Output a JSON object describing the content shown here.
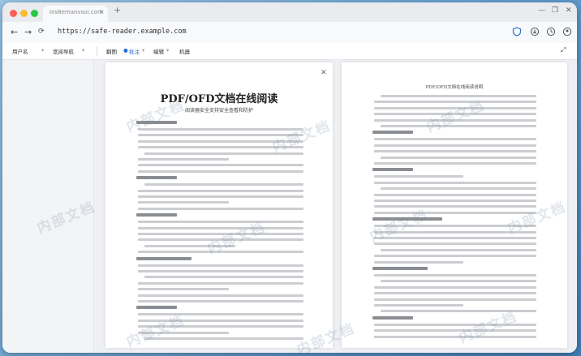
{
  "tab": {
    "title": "Ins8emanvsoi.com",
    "close": "×",
    "new": "+"
  },
  "nav": {
    "url": "https://safe-reader.example.com",
    "back": "←",
    "forward": "→",
    "reload": "C",
    "home": "⌂"
  },
  "toolbar": {
    "username": "用户名",
    "doc_select": "宽阅导航",
    "dropdown_arrow": "▾",
    "items": [
      "翻图",
      "批注",
      "编辑",
      "机器"
    ],
    "active_index": 1
  },
  "doc": {
    "title": "PDF/OFD文档在线阅读",
    "subtitle": "阅读器安全支持安全查看和防护",
    "page2_header": "PDF/OFD文档在线阅读说明"
  },
  "watermark": "内部文档",
  "colors": {
    "red": "#ff5f57",
    "yellow": "#febc2e",
    "green": "#28c840",
    "accent": "#2a6fd6"
  }
}
